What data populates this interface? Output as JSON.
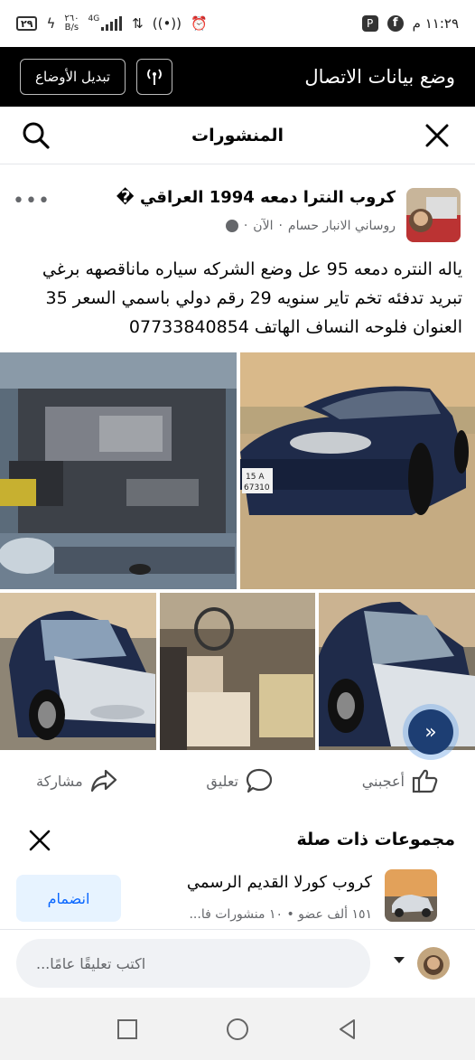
{
  "status_bar": {
    "time": "١١:٢٩ م",
    "battery": "٢٩",
    "net_speed_top": "٢٦٠",
    "net_speed_unit": "B/s",
    "network_type": "4G"
  },
  "data_bar": {
    "title": "وضع بيانات الاتصال",
    "toggle_label": "تبديل الأوضاع"
  },
  "header": {
    "title": "المنشورات"
  },
  "post": {
    "group_name": "كروب النترا دمعه 1994 العراقي �",
    "author": "روساني الانبار حسام",
    "time": "الآن",
    "text": "ياله النتره دمعه 95 عل وضع الشركه سياره ماناقصهه برغي تبريد تدفئه تخم تاير سنويه 29 رقم دولي باسمي السعر 35 العنوان فلوحه النساف الهاتف 07733840854",
    "plate_text_1": "15 A",
    "plate_text_2": "67310"
  },
  "actions": {
    "like": "أعجبني",
    "comment": "تعليق",
    "share": "مشاركة"
  },
  "related": {
    "title": "مجموعات ذات صلة",
    "group": {
      "name": "كروب كورلا القديم الرسمي",
      "stats": "١٥١ ألف عضو • ١٠ منشورات فا...",
      "join_label": "انضمام"
    }
  },
  "composer": {
    "placeholder": "اكتب تعليقًا عامًا..."
  },
  "colors": {
    "accent": "#0866ff",
    "join_bg": "#e7f3ff",
    "fab": "#1d3e73",
    "car_body": "#1f2b4a"
  }
}
